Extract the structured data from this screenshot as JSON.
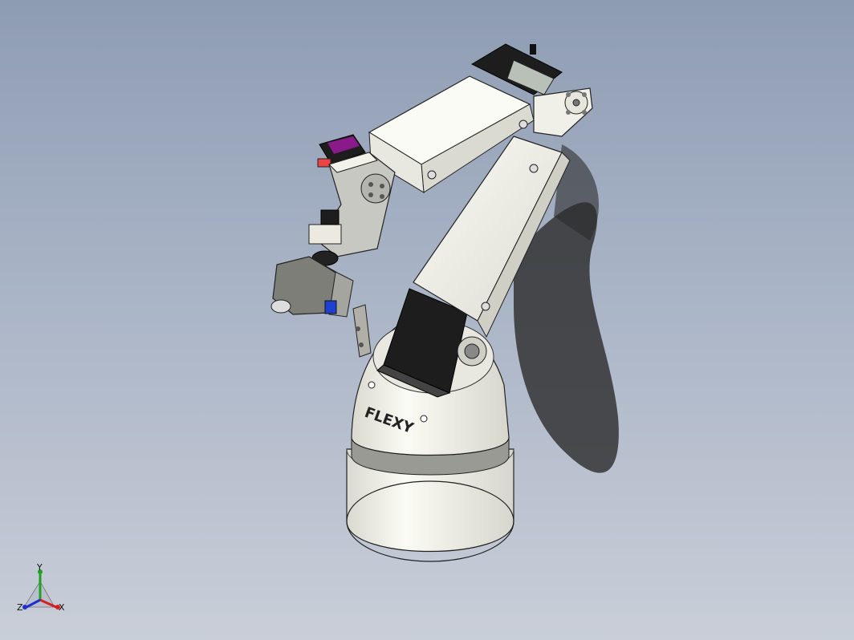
{
  "viewport": {
    "background_top": "#8e9cb3",
    "background_bottom": "#c9ced8"
  },
  "model": {
    "base_label": "FLEXY",
    "part_color": "#f1f1ea",
    "servo_color": "#1d1d1d",
    "accent_purple": "#8a1a8a",
    "accent_blue": "#1f3fd0"
  },
  "triad": {
    "x_label": "X",
    "y_label": "Y",
    "z_label": "Z",
    "x_color": "#d42020",
    "y_color": "#20a020",
    "z_color": "#2030d0"
  }
}
